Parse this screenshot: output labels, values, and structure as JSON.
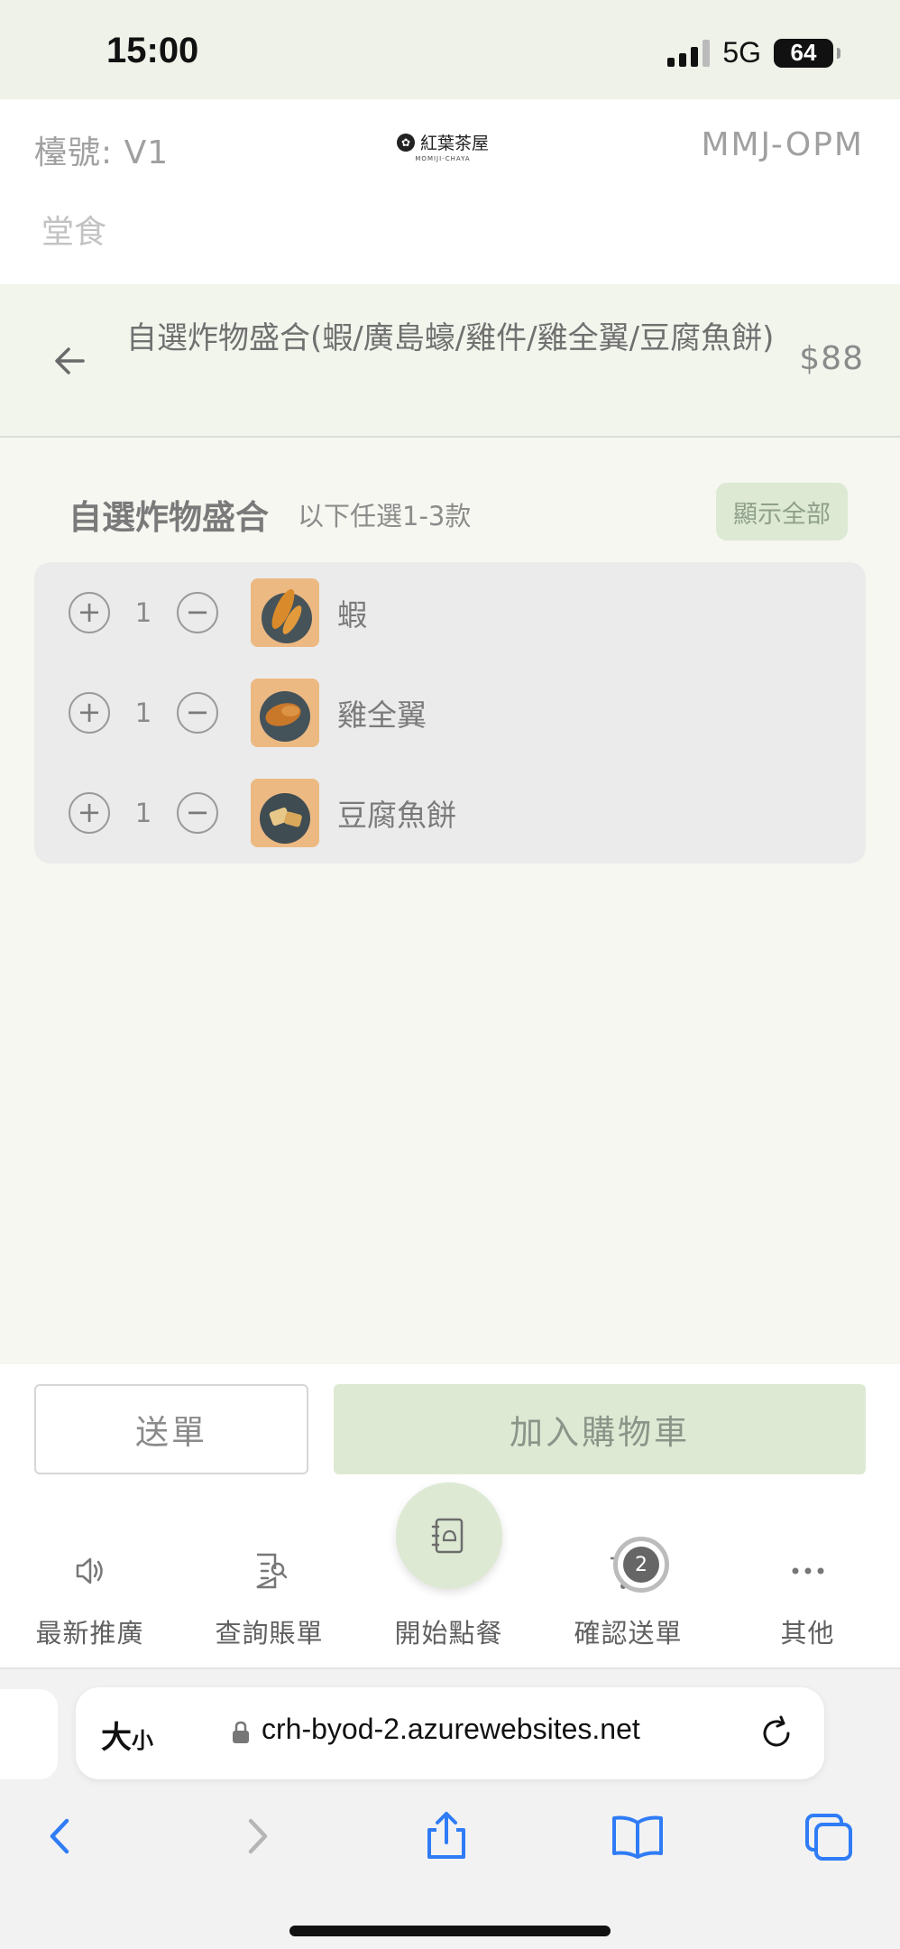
{
  "status_bar": {
    "time": "15:00",
    "network": "5G",
    "battery": "64"
  },
  "header": {
    "table_no": "檯號: V1",
    "logo_text": "紅葉茶屋",
    "logo_sub": "MOMIJI-CHAYA",
    "store_code": "MMJ-OPM",
    "dine_type": "堂食"
  },
  "item": {
    "title": "自選炸物盛合(蝦/廣島蠔/雞件/雞全翼/豆腐魚餅)",
    "price": "$88"
  },
  "option_group": {
    "title": "自選炸物盛合",
    "hint": "以下任選1-3款",
    "show_all_label": "顯示全部",
    "options": [
      {
        "name": "蝦",
        "qty": "1"
      },
      {
        "name": "雞全翼",
        "qty": "1"
      },
      {
        "name": "豆腐魚餅",
        "qty": "1"
      }
    ]
  },
  "actions": {
    "send_label": "送單",
    "add_to_cart_label": "加入購物車"
  },
  "tabs": [
    {
      "label": "最新推廣",
      "icon": "speaker-icon"
    },
    {
      "label": "查詢賬單",
      "icon": "bill-search-icon"
    },
    {
      "label": "開始點餐",
      "icon": "menu-book-icon"
    },
    {
      "label": "確認送單",
      "icon": "cart-icon",
      "badge": "2"
    },
    {
      "label": "其他",
      "icon": "more-icon"
    }
  ],
  "browser": {
    "text_size_label": "大",
    "text_size_small": "小",
    "url": "crh-byod-2.azurewebsites.net"
  },
  "colors": {
    "accent": "#dde9d3",
    "background": "#f5f7f0"
  }
}
